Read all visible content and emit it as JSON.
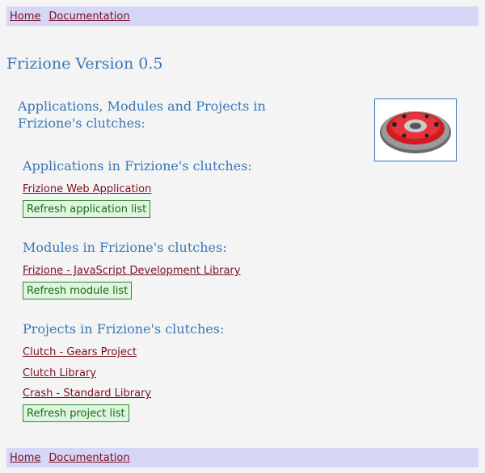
{
  "nav": {
    "home": "Home",
    "documentation": "Documentation"
  },
  "title": "Frizione Version 0.5",
  "subtitle": "Applications, Modules and Projects in Frizione's clutches:",
  "applications": {
    "heading": "Applications in Frizione's clutches:",
    "items": [
      "Frizione Web Application"
    ],
    "refresh": "Refresh application list"
  },
  "modules": {
    "heading": "Modules in Frizione's clutches:",
    "items": [
      "Frizione - JavaScript Development Library"
    ],
    "refresh": "Refresh module list"
  },
  "projects": {
    "heading": "Projects in Frizione's clutches:",
    "items": [
      "Clutch - Gears Project",
      "Clutch Library",
      "Crash - Standard Library"
    ],
    "refresh": "Refresh project list"
  },
  "colors": {
    "heading": "#3a78b8",
    "link": "#7b1020",
    "nav_bg": "#d6d6f7",
    "button_bg": "#dff5df"
  }
}
